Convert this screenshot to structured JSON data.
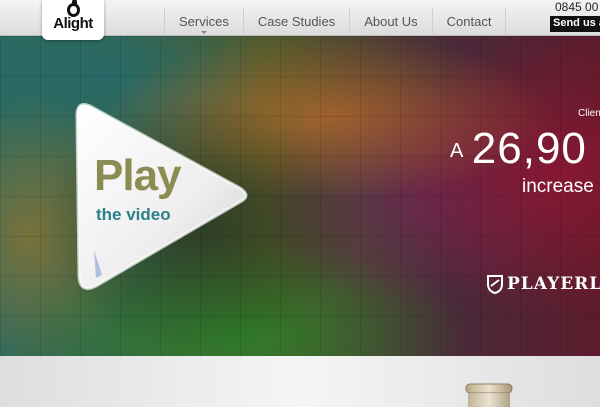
{
  "logo": {
    "text": "Alight"
  },
  "nav": {
    "items": [
      {
        "label": "Services"
      },
      {
        "label": "Case Studies"
      },
      {
        "label": "About Us"
      },
      {
        "label": "Contact"
      }
    ]
  },
  "contact": {
    "phone": "0845 00",
    "send_button": "Send us a"
  },
  "hero": {
    "play_word": "Play",
    "play_sub": "the video",
    "client_label": "Clien",
    "stat_prefix": "A",
    "stat_value": "26,90",
    "stat_sub": "increase",
    "brand": "PLAYERLA"
  },
  "colors": {
    "play_text": "#8a8c52",
    "play_sub_text": "#2f7f86",
    "send_button_bg": "#111111"
  },
  "icons": [
    "play-icon",
    "logo-mark-icon",
    "shield-icon",
    "nav-caret-icon"
  ]
}
